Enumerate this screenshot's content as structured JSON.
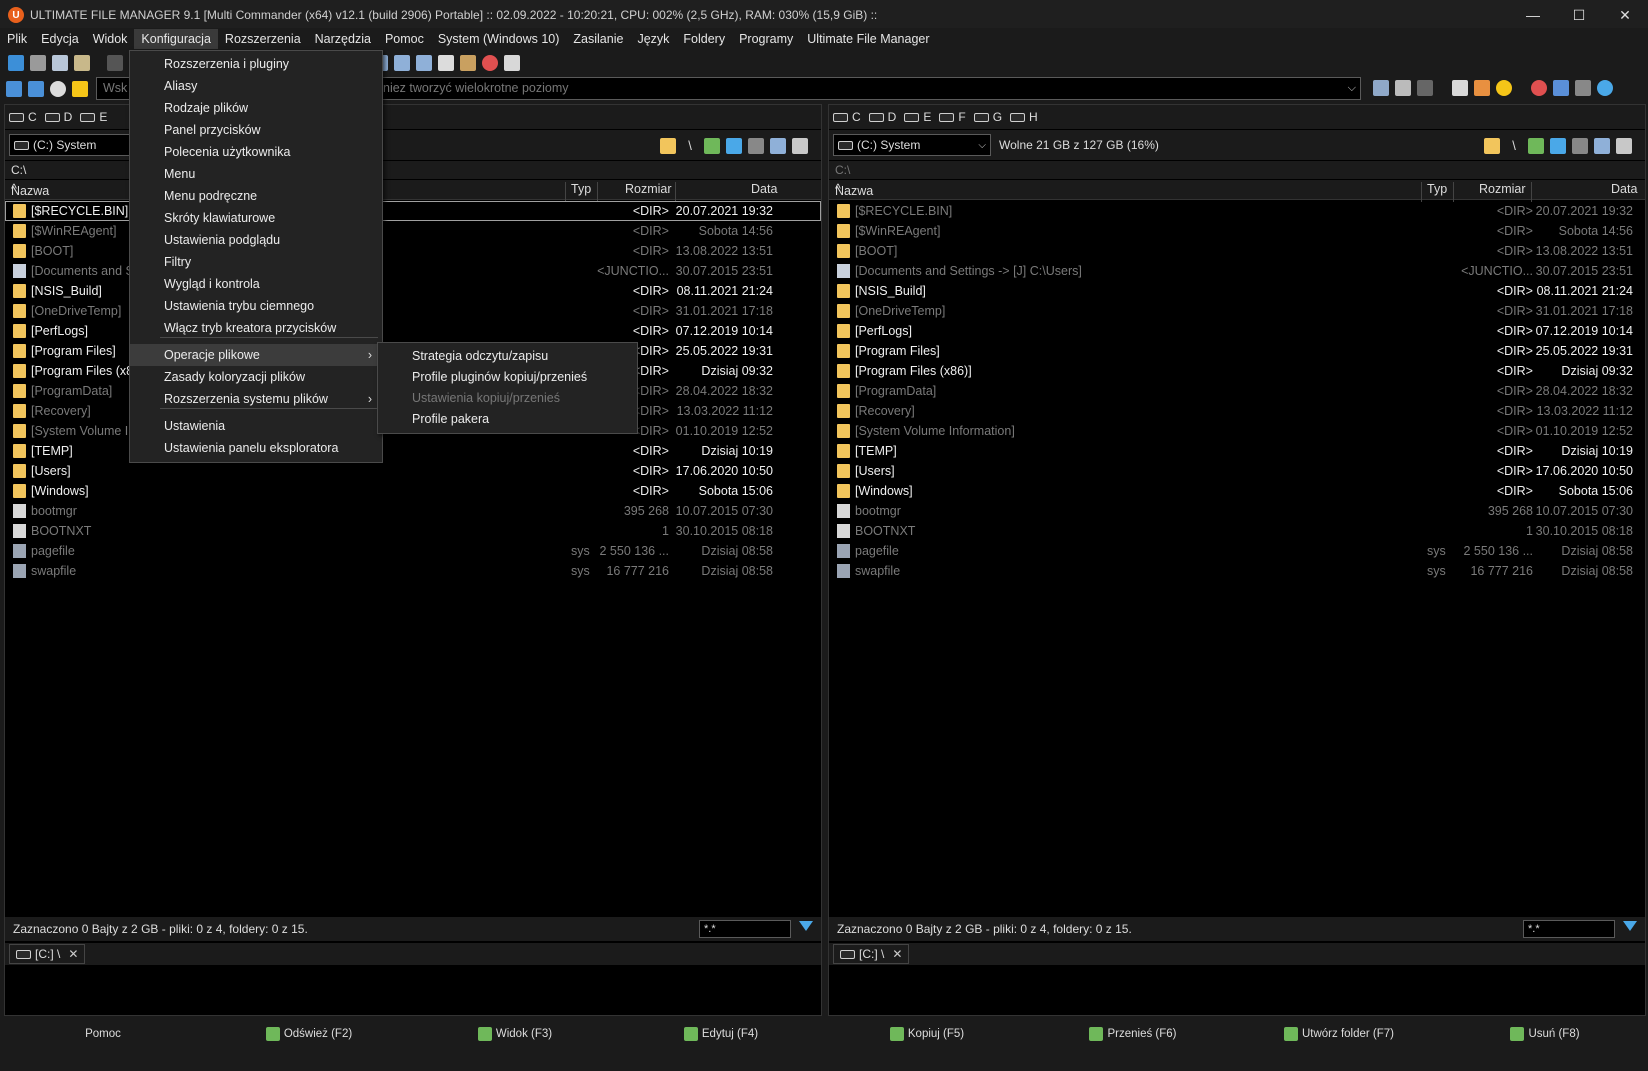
{
  "window": {
    "title": "ULTIMATE FILE MANAGER 9.1 [Multi Commander (x64)  v12.1 (build 2906) Portable] :: 02.09.2022 - 10:20:21, CPU: 002% (2,5 GHz), RAM: 030% (15,9 GiB) ::",
    "minimize": "—",
    "maximize": "☐",
    "close": "✕"
  },
  "menubar": [
    "Plik",
    "Edycja",
    "Widok",
    "Konfiguracja",
    "Rozszerzenia",
    "Narzędzia",
    "Pomoc",
    "System (Windows 10)",
    "Zasilanie",
    "Język",
    "Foldery",
    "Programy",
    "Ultimate File Manager"
  ],
  "address": {
    "visible_left": "Wsk",
    "visible_right": "niez tworzyć wielokrotne poziomy"
  },
  "dropdown": {
    "items": [
      {
        "label": "Rozszerzenia i pluginy"
      },
      {
        "label": "Aliasy"
      },
      {
        "label": "Rodzaje plików"
      },
      {
        "label": "Panel przycisków"
      },
      {
        "label": "Polecenia użytkownika"
      },
      {
        "label": "Menu"
      },
      {
        "label": "Menu podręczne"
      },
      {
        "label": "Skróty klawiaturowe"
      },
      {
        "label": "Ustawienia podglądu"
      },
      {
        "label": "Filtry"
      },
      {
        "label": "Wygląd i kontrola"
      },
      {
        "label": "Ustawienia trybu ciemnego"
      },
      {
        "label": "Włącz tryb kreatora przycisków"
      },
      {
        "label": "Operacje plikowe",
        "submenu": true
      },
      {
        "label": "Zasady koloryzacji plików"
      },
      {
        "label": "Rozszerzenia systemu plików",
        "submenu": true
      },
      {
        "label": "Ustawienia"
      },
      {
        "label": "Ustawienia panelu eksploratora"
      }
    ],
    "arrow": "›"
  },
  "submenu": {
    "items": [
      {
        "label": "Strategia odczytu/zapisu",
        "disabled": false
      },
      {
        "label": "Profile pluginów kopiuj/przenieś",
        "disabled": false
      },
      {
        "label": "Ustawienia kopiuj/przenieś",
        "disabled": true
      },
      {
        "label": "Profile pakera",
        "disabled": false
      }
    ]
  },
  "left_panel": {
    "drives": [
      "C",
      "D",
      "E"
    ],
    "drive_select": "(C:) System",
    "path": "C:\\",
    "columns": {
      "name": "Nazwa",
      "type": "Typ",
      "size": "Rozmiar",
      "date": "Data"
    },
    "status": "Zaznaczono 0 Bajty z 2 GB - pliki: 0 z 4, foldery: 0 z 15.",
    "filter": "*.*",
    "tab": "[C:] \\",
    "tab_close": "✕"
  },
  "right_panel": {
    "drives": [
      "C",
      "D",
      "E",
      "F",
      "G",
      "H"
    ],
    "drive_select": "(C:) System",
    "free_space": "Wolne 21 GB z 127 GB (16%)",
    "path": "C:\\",
    "columns": {
      "name": "Nazwa",
      "type": "Typ",
      "size": "Rozmiar",
      "date": "Data"
    },
    "status": "Zaznaczono 0 Bajty z 2 GB - pliki: 0 z 4, foldery: 0 z 15.",
    "filter": "*.*",
    "tab": "[C:] \\",
    "tab_close": "✕"
  },
  "files_left": [
    {
      "name": "[$RECYCLE.BIN]",
      "type": "",
      "size": "<DIR>",
      "date": "20.07.2021 19:32",
      "kind": "folder",
      "dim": false
    },
    {
      "name": "[$WinREAgent]",
      "type": "",
      "size": "<DIR>",
      "date": "Sobota 14:56",
      "kind": "folder",
      "dim": true
    },
    {
      "name": "[BOOT]",
      "type": "",
      "size": "<DIR>",
      "date": "13.08.2022 13:51",
      "kind": "folder",
      "dim": true
    },
    {
      "name": "[Documents and S",
      "type": "",
      "size": "<JUNCTIO...",
      "date": "30.07.2015 23:51",
      "kind": "link",
      "dim": true
    },
    {
      "name": "[NSIS_Build]",
      "type": "",
      "size": "<DIR>",
      "date": "08.11.2021 21:24",
      "kind": "folder",
      "dim": false
    },
    {
      "name": "[OneDriveTemp]",
      "type": "",
      "size": "<DIR>",
      "date": "31.01.2021 17:18",
      "kind": "folder",
      "dim": true
    },
    {
      "name": "[PerfLogs]",
      "type": "",
      "size": "<DIR>",
      "date": "07.12.2019 10:14",
      "kind": "folder",
      "dim": false
    },
    {
      "name": "[Program Files]",
      "type": "",
      "size": "<DIR>",
      "date": "25.05.2022 19:31",
      "kind": "folder",
      "dim": false
    },
    {
      "name": "[Program Files (x8",
      "type": "",
      "size": "<DIR>",
      "date": "Dzisiaj 09:32",
      "kind": "folder",
      "dim": false
    },
    {
      "name": "[ProgramData]",
      "type": "",
      "size": "<DIR>",
      "date": "28.04.2022 18:32",
      "kind": "folder",
      "dim": true
    },
    {
      "name": "[Recovery]",
      "type": "",
      "size": "<DIR>",
      "date": "13.03.2022 11:12",
      "kind": "folder",
      "dim": true
    },
    {
      "name": "[System Volume In",
      "type": "",
      "size": "<DIR>",
      "date": "01.10.2019 12:52",
      "kind": "folder",
      "dim": true
    },
    {
      "name": "[TEMP]",
      "type": "",
      "size": "<DIR>",
      "date": "Dzisiaj 10:19",
      "kind": "folder",
      "dim": false
    },
    {
      "name": "[Users]",
      "type": "",
      "size": "<DIR>",
      "date": "17.06.2020 10:50",
      "kind": "folder",
      "dim": false
    },
    {
      "name": "[Windows]",
      "type": "",
      "size": "<DIR>",
      "date": "Sobota 15:06",
      "kind": "folder",
      "dim": false
    },
    {
      "name": "bootmgr",
      "type": "",
      "size": "395 268",
      "date": "10.07.2015 07:30",
      "kind": "file",
      "dim": true
    },
    {
      "name": "BOOTNXT",
      "type": "",
      "size": "1",
      "date": "30.10.2015 08:18",
      "kind": "file",
      "dim": true
    },
    {
      "name": "pagefile",
      "type": "sys",
      "size": "2 550 136 ...",
      "date": "Dzisiaj 08:58",
      "kind": "sysf",
      "dim": true
    },
    {
      "name": "swapfile",
      "type": "sys",
      "size": "16 777 216",
      "date": "Dzisiaj 08:58",
      "kind": "sysf",
      "dim": true
    }
  ],
  "files_right": [
    {
      "name": "[$RECYCLE.BIN]",
      "type": "",
      "size": "<DIR>",
      "date": "20.07.2021 19:32",
      "kind": "folder",
      "dim": true
    },
    {
      "name": "[$WinREAgent]",
      "type": "",
      "size": "<DIR>",
      "date": "Sobota 14:56",
      "kind": "folder",
      "dim": true
    },
    {
      "name": "[BOOT]",
      "type": "",
      "size": "<DIR>",
      "date": "13.08.2022 13:51",
      "kind": "folder",
      "dim": true
    },
    {
      "name": "[Documents and Settings ->  [J] C:\\Users]",
      "type": "",
      "size": "<JUNCTIO...",
      "date": "30.07.2015 23:51",
      "kind": "link",
      "dim": true
    },
    {
      "name": "[NSIS_Build]",
      "type": "",
      "size": "<DIR>",
      "date": "08.11.2021 21:24",
      "kind": "folder",
      "dim": false
    },
    {
      "name": "[OneDriveTemp]",
      "type": "",
      "size": "<DIR>",
      "date": "31.01.2021 17:18",
      "kind": "folder",
      "dim": true
    },
    {
      "name": "[PerfLogs]",
      "type": "",
      "size": "<DIR>",
      "date": "07.12.2019 10:14",
      "kind": "folder",
      "dim": false
    },
    {
      "name": "[Program Files]",
      "type": "",
      "size": "<DIR>",
      "date": "25.05.2022 19:31",
      "kind": "folder",
      "dim": false
    },
    {
      "name": "[Program Files (x86)]",
      "type": "",
      "size": "<DIR>",
      "date": "Dzisiaj 09:32",
      "kind": "folder",
      "dim": false
    },
    {
      "name": "[ProgramData]",
      "type": "",
      "size": "<DIR>",
      "date": "28.04.2022 18:32",
      "kind": "folder",
      "dim": true
    },
    {
      "name": "[Recovery]",
      "type": "",
      "size": "<DIR>",
      "date": "13.03.2022 11:12",
      "kind": "folder",
      "dim": true
    },
    {
      "name": "[System Volume Information]",
      "type": "",
      "size": "<DIR>",
      "date": "01.10.2019 12:52",
      "kind": "folder",
      "dim": true
    },
    {
      "name": "[TEMP]",
      "type": "",
      "size": "<DIR>",
      "date": "Dzisiaj 10:19",
      "kind": "folder",
      "dim": false
    },
    {
      "name": "[Users]",
      "type": "",
      "size": "<DIR>",
      "date": "17.06.2020 10:50",
      "kind": "folder",
      "dim": false
    },
    {
      "name": "[Windows]",
      "type": "",
      "size": "<DIR>",
      "date": "Sobota 15:06",
      "kind": "folder",
      "dim": false
    },
    {
      "name": "bootmgr",
      "type": "",
      "size": "395 268",
      "date": "10.07.2015 07:30",
      "kind": "file",
      "dim": true
    },
    {
      "name": "BOOTNXT",
      "type": "",
      "size": "1",
      "date": "30.10.2015 08:18",
      "kind": "file",
      "dim": true
    },
    {
      "name": "pagefile",
      "type": "sys",
      "size": "2 550 136 ...",
      "date": "Dzisiaj 08:58",
      "kind": "sysf",
      "dim": true
    },
    {
      "name": "swapfile",
      "type": "sys",
      "size": "16 777 216",
      "date": "Dzisiaj 08:58",
      "kind": "sysf",
      "dim": true
    }
  ],
  "function_bar": [
    "Pomoc",
    "Odśwież (F2)",
    "Widok (F3)",
    "Edytuj (F4)",
    "Kopiuj (F5)",
    "Przenieś (F6)",
    "Utwórz folder (F7)",
    "Usuń (F8)"
  ],
  "colors": {
    "accent": "#4aa8e8",
    "folder": "#f2c55c",
    "app_icon": "#e8601c"
  }
}
